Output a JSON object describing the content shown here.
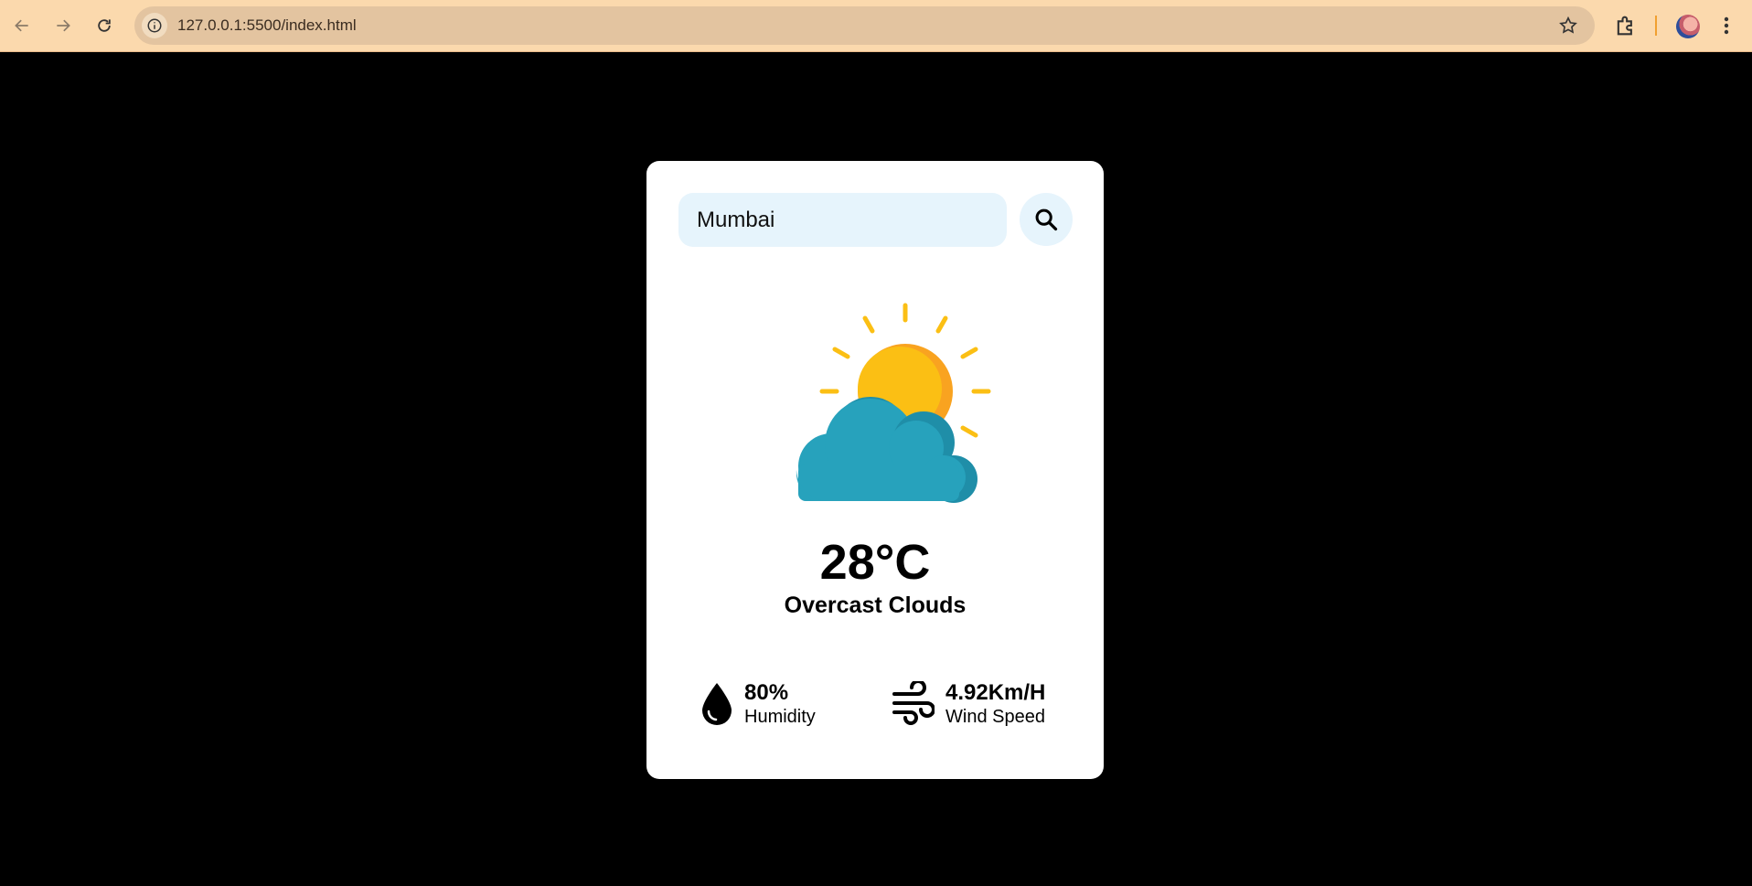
{
  "browser": {
    "url": "127.0.0.1:5500/index.html"
  },
  "weather": {
    "search_value": "Mumbai",
    "temperature": "28°C",
    "condition": "Overcast Clouds",
    "humidity_value": "80%",
    "humidity_label": "Humidity",
    "wind_value": "4.92Km/H",
    "wind_label": "Wind Speed",
    "icon": "sun-behind-cloud-icon"
  },
  "colors": {
    "page_background": "#000000",
    "card_background": "#ffffff",
    "input_background": "#e6f4fc",
    "toolbar_background": "#fbd9ad",
    "sun": "#fbbf14",
    "cloud": "#27a2bc"
  }
}
